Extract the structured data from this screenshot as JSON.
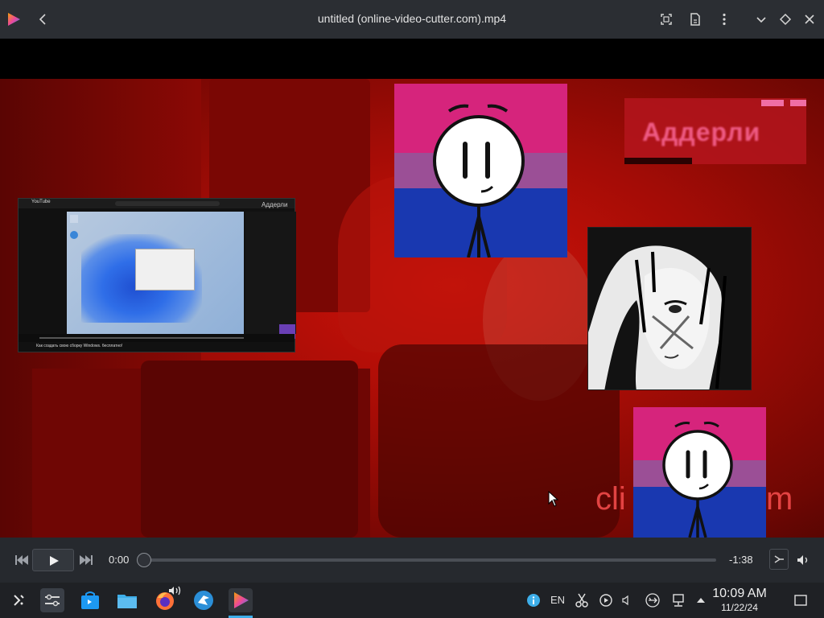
{
  "window": {
    "title": "untitled (online-video-cutter.com).mp4"
  },
  "icons": {
    "app": "media-player-icon",
    "back": "back-arrow-icon",
    "fit": "fit-screen-icon",
    "playlist": "playlist-icon",
    "menu": "kebab-menu-icon",
    "minimize": "chevron-down-icon",
    "float": "diamond-icon",
    "close": "close-icon"
  },
  "video": {
    "overlay_text_top_right": "Аддерли",
    "overlay_text_bottom_right_left": "cli",
    "overlay_text_bottom_right_right": "m",
    "pip_caption": "Как создать свою сборку Windows. бесплатно!",
    "pip_channel": "YouTube",
    "pip_overlay_name": "Аддерли"
  },
  "playback": {
    "position": "0:00",
    "remaining": "-1:38",
    "progress": 0.0
  },
  "taskbar": {
    "lang": "EN",
    "time": "10:09 AM",
    "date": "11/22/24"
  },
  "colors": {
    "accent": "#3b82f6",
    "frame_red": "#c10f07",
    "bi_pink": "#d6247c",
    "bi_purple": "#9b4f96",
    "bi_blue": "#1938b0"
  }
}
